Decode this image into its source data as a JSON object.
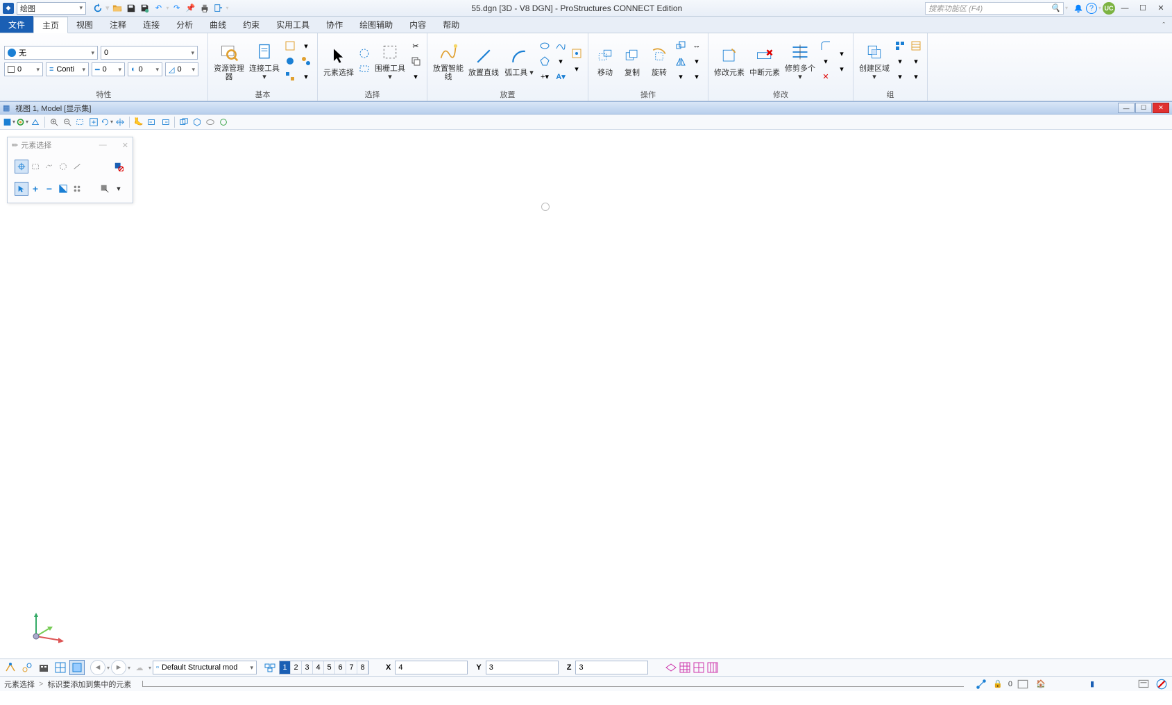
{
  "titlebar": {
    "workflow_label": "绘图",
    "app_title": "55.dgn [3D - V8 DGN] - ProStructures CONNECT Edition",
    "search_placeholder": "搜索功能区 (F4)",
    "user_badge": "UC"
  },
  "tabs": {
    "file": "文件",
    "home": "主页",
    "view": "视图",
    "annotate": "注释",
    "connect": "连接",
    "analyze": "分析",
    "curve": "曲线",
    "constraint": "约束",
    "util": "实用工具",
    "collab": "协作",
    "draw_aid": "绘图辅助",
    "content": "内容",
    "help": "帮助"
  },
  "ribbon": {
    "attrs": {
      "layer_value": "无",
      "level_value": "0",
      "color_value": "0",
      "linestyle_value": "Conti",
      "weight_value": "0",
      "transparency_value": "0",
      "priority_value": "0",
      "group_label": "特性"
    },
    "basic": {
      "manager": "资源管理器",
      "connect_tool": "连接工具",
      "group_label": "基本"
    },
    "select": {
      "elem_select": "元素选择",
      "fence": "围栅工具",
      "group_label": "选择"
    },
    "place": {
      "smartline": "放置智能线",
      "line": "放置直线",
      "arc": "弧工具",
      "group_label": "放置"
    },
    "manip": {
      "move": "移动",
      "copy": "复制",
      "rotate": "旋转",
      "group_label": "操作"
    },
    "modify": {
      "mod_elem": "修改元素",
      "break_elem": "中断元素",
      "trim": "修剪多个",
      "group_label": "修改"
    },
    "group": {
      "region": "创建区域",
      "group_label": "组"
    }
  },
  "viewtitle": "视图 1, Model [显示集]",
  "tool_palette": {
    "title": "元素选择"
  },
  "bottomtb": {
    "model_combo": "Default Structural mod",
    "coord_x": "4",
    "coord_y": "3",
    "coord_z": "3",
    "views": [
      "1",
      "2",
      "3",
      "4",
      "5",
      "6",
      "7",
      "8"
    ],
    "x_label": "X",
    "y_label": "Y",
    "z_label": "Z"
  },
  "statusbar": {
    "left_major": "元素选择",
    "left_minor": "标识要添加到集中的元素",
    "lock_count": "0"
  }
}
